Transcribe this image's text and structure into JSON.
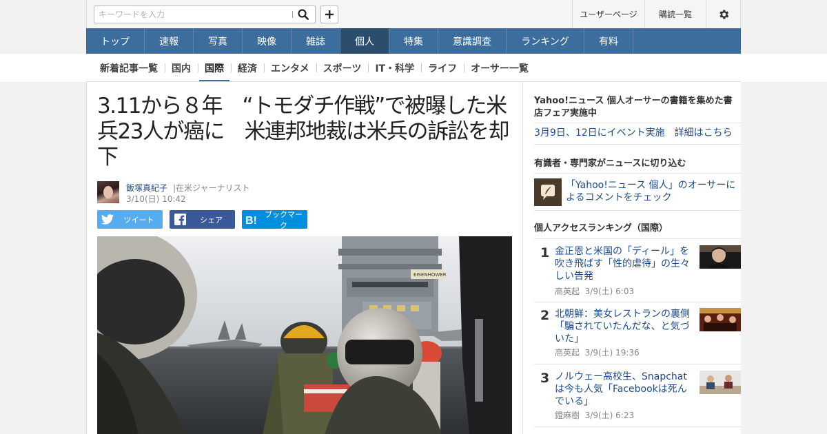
{
  "search": {
    "placeholder": "キーワードを入力",
    "icon": "search-icon",
    "add_icon": "plus-icon"
  },
  "header": {
    "mypage": "ユーザーページ",
    "subscriptions": "購読一覧",
    "settings_icon": "gear-icon"
  },
  "main_nav": {
    "items": [
      {
        "label": "トップ"
      },
      {
        "label": "速報"
      },
      {
        "label": "写真"
      },
      {
        "label": "映像"
      },
      {
        "label": "雑誌"
      },
      {
        "label": "個人"
      },
      {
        "label": "特集"
      },
      {
        "label": "意識調査"
      },
      {
        "label": "ランキング"
      },
      {
        "label": "有料"
      }
    ],
    "active": "個人"
  },
  "sub_nav": {
    "items": [
      {
        "label": "新着記事一覧"
      },
      {
        "label": "国内"
      },
      {
        "label": "国際"
      },
      {
        "label": "経済"
      },
      {
        "label": "エンタメ"
      },
      {
        "label": "スポーツ"
      },
      {
        "label": "IT・科学"
      },
      {
        "label": "ライフ"
      },
      {
        "label": "オーサー一覧"
      }
    ],
    "active": "国際"
  },
  "article": {
    "headline": "3.11から８年　“トモダチ作戦”で被曝した米兵23人が癌に　米連邦地裁は米兵の訴訟を却下",
    "author": {
      "name": "飯塚真紀子",
      "title": "|在米ジャーナリスト"
    },
    "date": "3/10(日) 10:42",
    "share": {
      "tweet": "ツイート",
      "facebook": "シェア",
      "bookmark": "ブックマーク"
    },
    "carrier_hull_text": "EISENHOWER"
  },
  "sidebar": {
    "fair": {
      "heading": "Yahoo!ニュース 個人オーサーの書籍を集めた書店フェア実施中",
      "link": "3月9日、12日にイベント実施　詳細はこちら"
    },
    "experts": {
      "heading": "有識者・専門家がニュースに切り込む",
      "link": "「Yahoo!ニュース 個人」のオーサーによるコメントをチェック"
    },
    "ranking": {
      "heading": "個人アクセスランキング（国際）",
      "items": [
        {
          "rank": "1",
          "title": "金正恩と米国の「ディール」を吹き飛ばす「性的虐待」の生々しい告発",
          "author": "高英起",
          "date": "3/9(土) 6:03"
        },
        {
          "rank": "2",
          "title": "北朝鮮：美女レストランの裏側「騙されていたんだな、と気づいた」",
          "author": "高英起",
          "date": "3/9(土) 19:36"
        },
        {
          "rank": "3",
          "title": "ノルウェー高校生、Snapchatは今も人気「Facebookは死んでいる」",
          "author": "鐙麻樹",
          "date": "3/9(土) 6:23"
        }
      ]
    }
  },
  "colors": {
    "nav_bg": "#3d6d9d",
    "nav_active": "#2b4d6e",
    "link": "#1c4b8c",
    "twitter": "#55acee",
    "facebook": "#3b5998",
    "hatena": "#008fde"
  }
}
